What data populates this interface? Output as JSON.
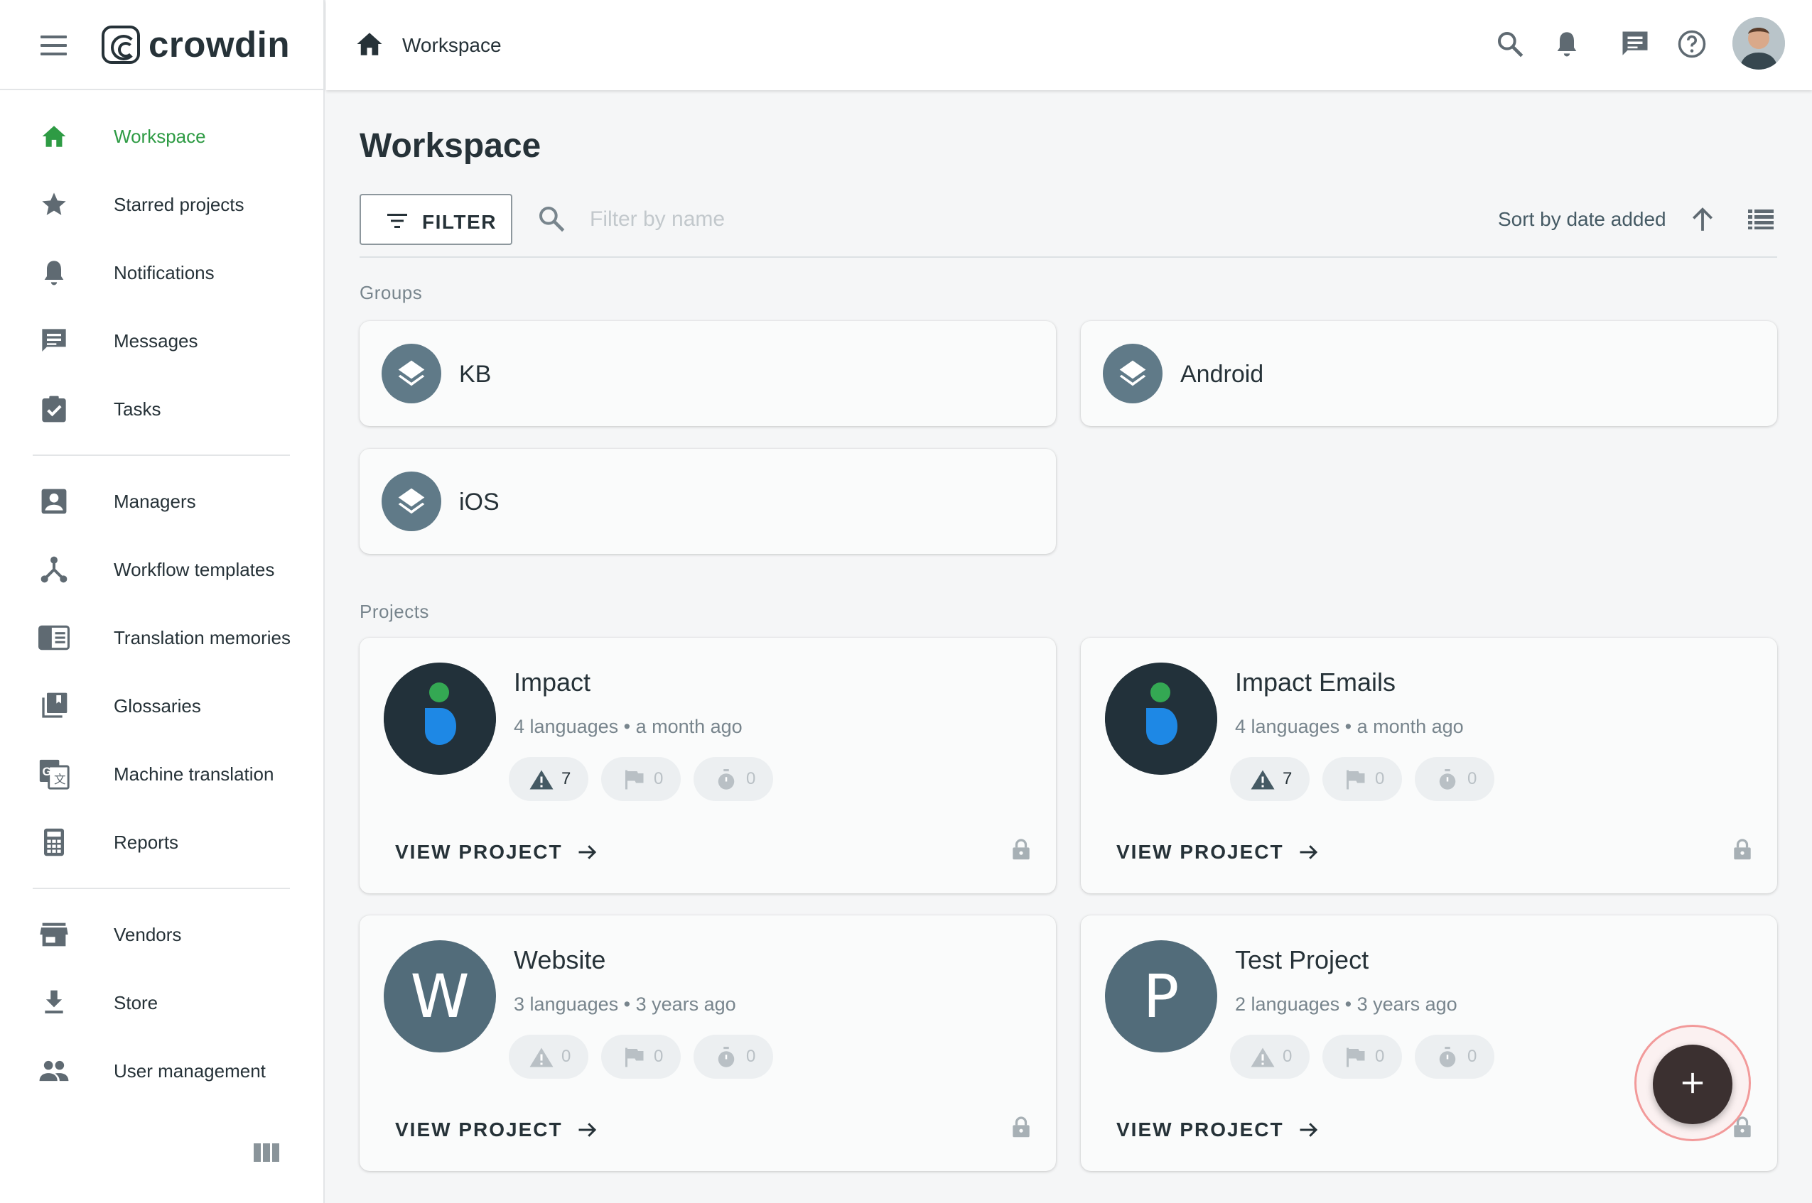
{
  "app": {
    "logo_text": "crowdin"
  },
  "sidebar": {
    "items": [
      {
        "label": "Workspace",
        "icon": "home-icon",
        "active": true
      },
      {
        "label": "Starred projects",
        "icon": "star-icon"
      },
      {
        "label": "Notifications",
        "icon": "bell-icon"
      },
      {
        "label": "Messages",
        "icon": "message-icon"
      },
      {
        "label": "Tasks",
        "icon": "task-icon"
      },
      {
        "label": "Managers",
        "icon": "manager-icon"
      },
      {
        "label": "Workflow templates",
        "icon": "workflow-icon"
      },
      {
        "label": "Translation memories",
        "icon": "translation-memory-icon"
      },
      {
        "label": "Glossaries",
        "icon": "glossary-icon"
      },
      {
        "label": "Machine translation",
        "icon": "machine-translation-icon"
      },
      {
        "label": "Reports",
        "icon": "calculator-icon"
      },
      {
        "label": "Vendors",
        "icon": "store-front-icon"
      },
      {
        "label": "Store",
        "icon": "download-icon"
      },
      {
        "label": "User management",
        "icon": "people-icon"
      }
    ]
  },
  "topbar": {
    "breadcrumb": "Workspace",
    "icons": [
      "search-icon",
      "bell-icon",
      "message-icon",
      "help-icon",
      "avatar"
    ]
  },
  "main": {
    "title": "Workspace",
    "filter_label": "FILTER",
    "filter_placeholder": "Filter by name",
    "sort_label": "Sort by date added",
    "groups_label": "Groups",
    "projects_label": "Projects",
    "view_project_label": "VIEW PROJECT"
  },
  "groups": [
    {
      "name": "KB"
    },
    {
      "name": "Android"
    },
    {
      "name": "iOS"
    }
  ],
  "projects": [
    {
      "name": "Impact",
      "meta": "4 languages • a month ago",
      "avatar": "impact-logo",
      "issues": "7",
      "flags": "0",
      "timers": "0"
    },
    {
      "name": "Impact Emails",
      "meta": "4 languages • a month ago",
      "avatar": "impact-logo",
      "issues": "7",
      "flags": "0",
      "timers": "0"
    },
    {
      "name": "Website",
      "meta": "3 languages • 3 years ago",
      "avatar_letter": "W",
      "issues": "0",
      "flags": "0",
      "timers": "0"
    },
    {
      "name": "Test Project",
      "meta": "2 languages • 3 years ago",
      "avatar_letter": "P",
      "issues": "0",
      "flags": "0",
      "timers": "0"
    }
  ],
  "colors": {
    "accent_green": "#2e9b44",
    "group_icon_bg": "#607a88",
    "fab_bg": "#3b3030",
    "text_primary": "#263238",
    "text_muted": "#78858d"
  }
}
